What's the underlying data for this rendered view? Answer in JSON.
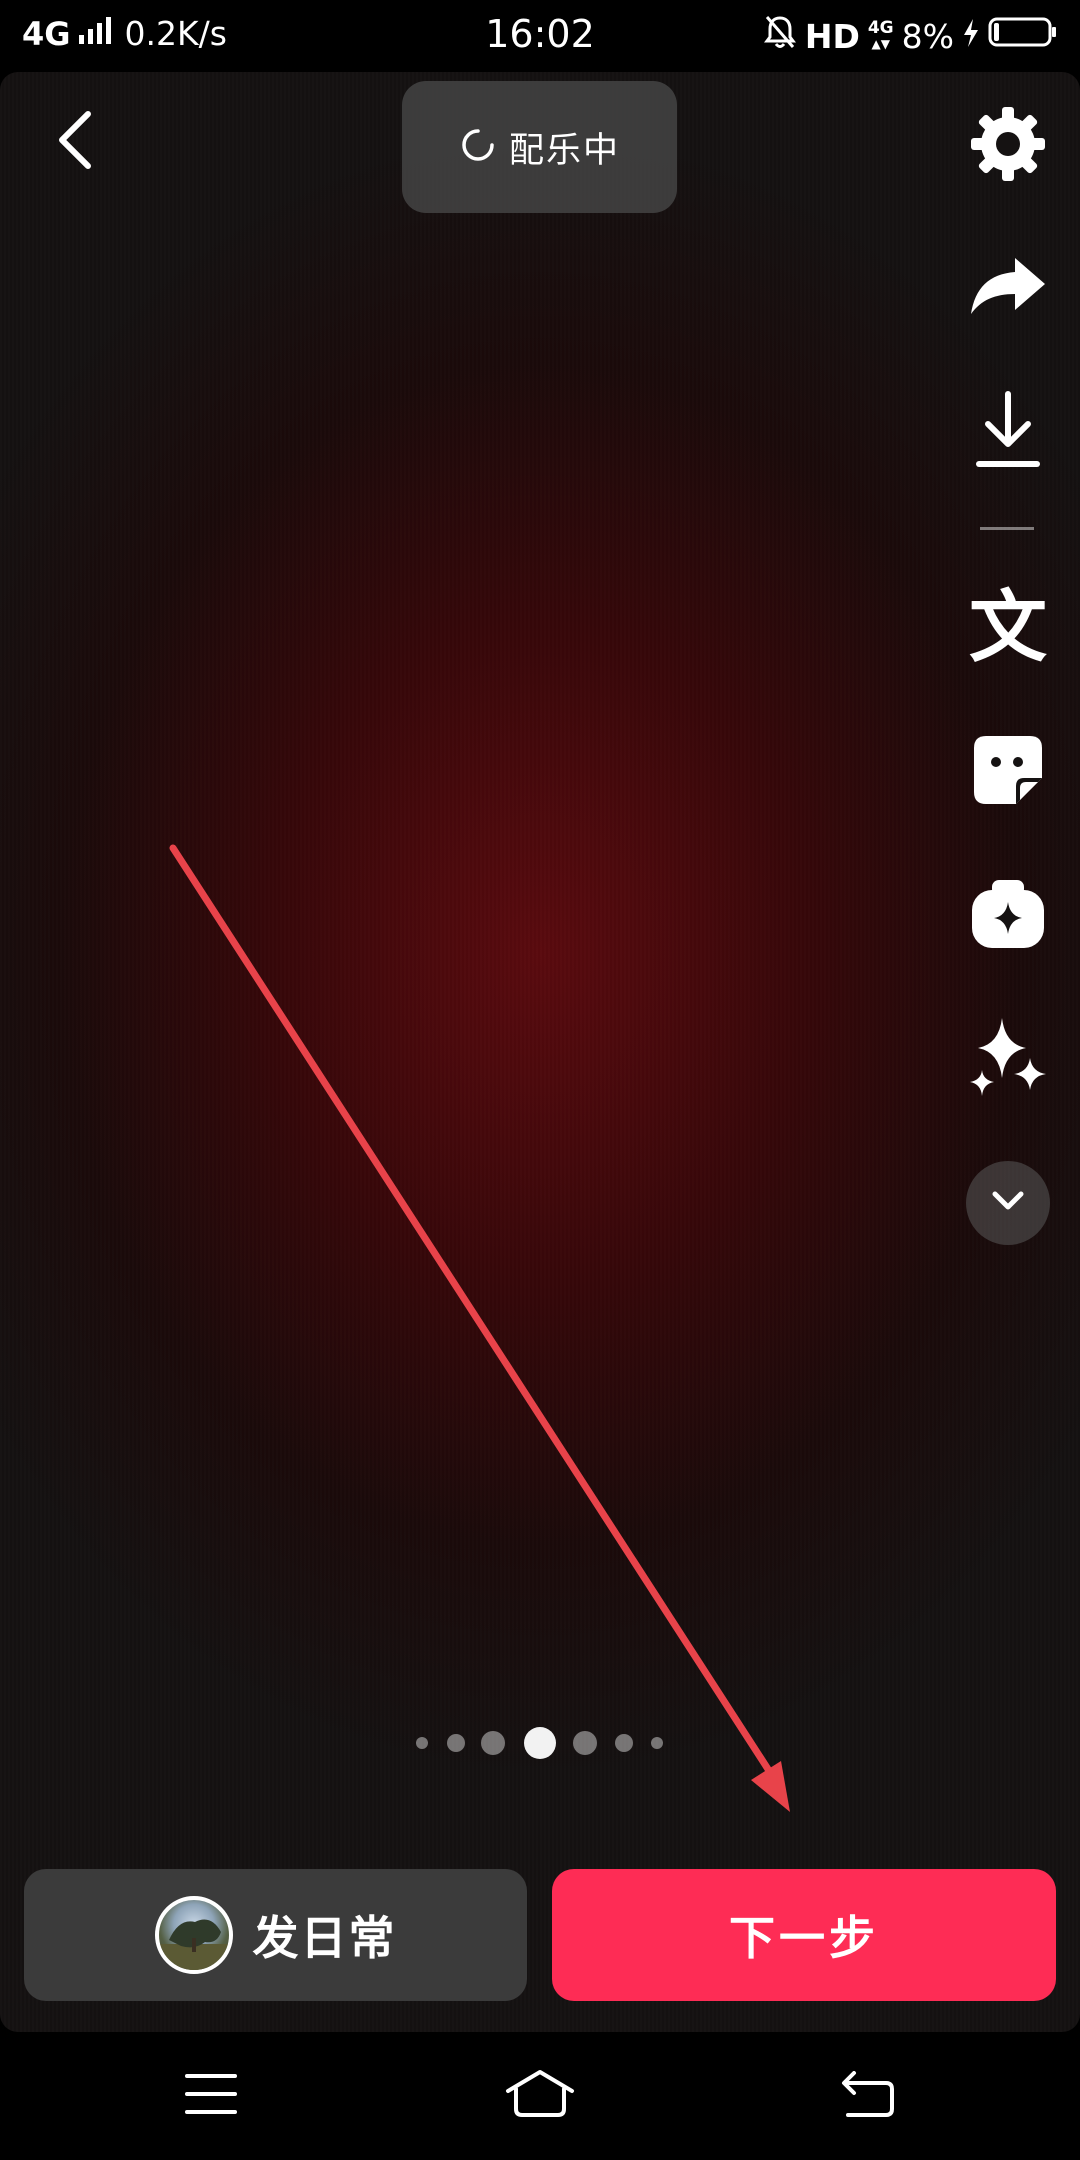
{
  "status_bar": {
    "network": "4G",
    "speed": "0.2K/s",
    "time": "16:02",
    "hd": "HD",
    "small_network": "4G",
    "battery": "8%"
  },
  "header": {
    "music_status": "配乐中"
  },
  "tools": {
    "text_glyph": "文"
  },
  "pager": {
    "dots": 7,
    "active_index": 3
  },
  "actions": {
    "daily_label": "发日常",
    "next_label": "下一步"
  },
  "colors": {
    "accent": "#fe2c55",
    "arrow": "#e8434a"
  },
  "icons": {
    "back": "back-arrow-icon",
    "settings": "gear-icon",
    "share": "share-icon",
    "download": "download-icon",
    "text": "text-icon",
    "sticker": "sticker-icon",
    "effects": "effects-icon",
    "enhance": "sparkle-icon",
    "more": "chevron-down-icon"
  }
}
